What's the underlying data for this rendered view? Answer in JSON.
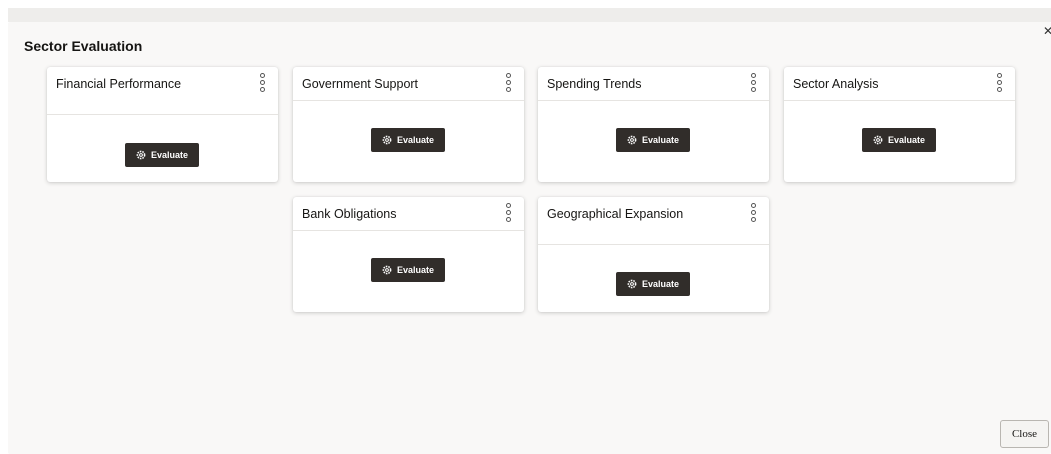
{
  "dialog": {
    "title": "Sector Evaluation",
    "close_icon": "close-icon",
    "close_label": "Close"
  },
  "cards": [
    {
      "title": "Financial Performance",
      "button_label": "Evaluate",
      "menu_icon": "kebab-menu-icon",
      "button_icon": "gear-icon"
    },
    {
      "title": "Government Support",
      "button_label": "Evaluate",
      "menu_icon": "kebab-menu-icon",
      "button_icon": "gear-icon"
    },
    {
      "title": "Spending Trends",
      "button_label": "Evaluate",
      "menu_icon": "kebab-menu-icon",
      "button_icon": "gear-icon"
    },
    {
      "title": "Sector Analysis",
      "button_label": "Evaluate",
      "menu_icon": "kebab-menu-icon",
      "button_icon": "gear-icon"
    },
    {
      "title": "Bank Obligations",
      "button_label": "Evaluate",
      "menu_icon": "kebab-menu-icon",
      "button_icon": "gear-icon"
    },
    {
      "title": "Geographical Expansion",
      "button_label": "Evaluate",
      "menu_icon": "kebab-menu-icon",
      "button_icon": "gear-icon"
    }
  ],
  "colors": {
    "button_bg": "#312d2a",
    "dialog_bg": "#f9f8f7",
    "card_bg": "#ffffff"
  }
}
